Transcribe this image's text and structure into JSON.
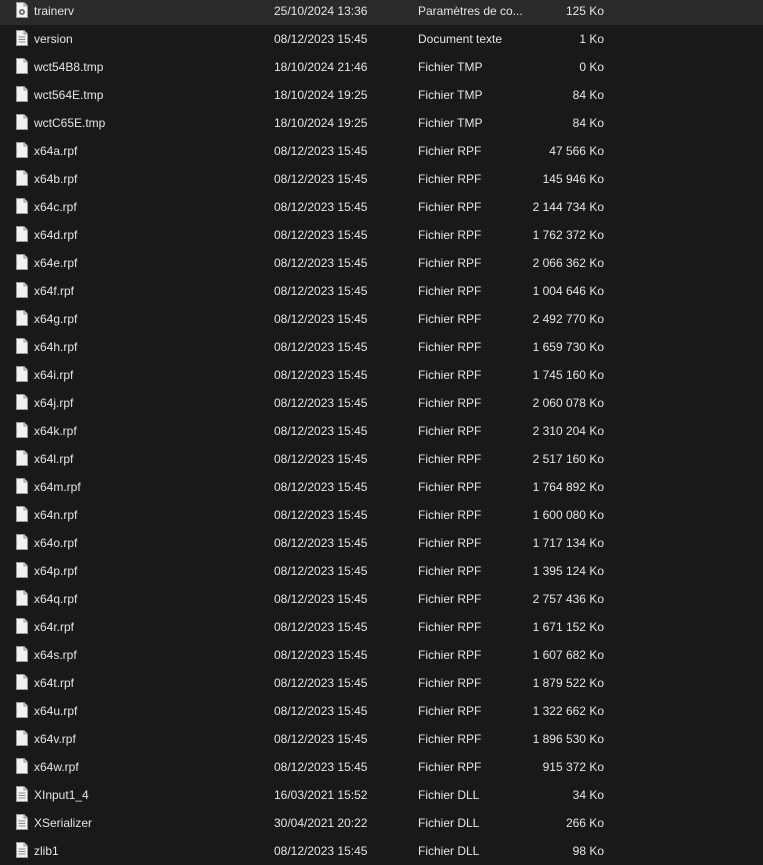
{
  "files": [
    {
      "name": "trainerv",
      "date": "25/10/2024 13:36",
      "type": "Paramètres de co...",
      "size": "125 Ko",
      "icon": "settings-file-icon"
    },
    {
      "name": "version",
      "date": "08/12/2023 15:45",
      "type": "Document texte",
      "size": "1 Ko",
      "icon": "text-document-icon"
    },
    {
      "name": "wct54B8.tmp",
      "date": "18/10/2024 21:46",
      "type": "Fichier TMP",
      "size": "0 Ko",
      "icon": "file-icon"
    },
    {
      "name": "wct564E.tmp",
      "date": "18/10/2024 19:25",
      "type": "Fichier TMP",
      "size": "84 Ko",
      "icon": "file-icon"
    },
    {
      "name": "wctC65E.tmp",
      "date": "18/10/2024 19:25",
      "type": "Fichier TMP",
      "size": "84 Ko",
      "icon": "file-icon"
    },
    {
      "name": "x64a.rpf",
      "date": "08/12/2023 15:45",
      "type": "Fichier RPF",
      "size": "47 566 Ko",
      "icon": "file-icon"
    },
    {
      "name": "x64b.rpf",
      "date": "08/12/2023 15:45",
      "type": "Fichier RPF",
      "size": "145 946 Ko",
      "icon": "file-icon"
    },
    {
      "name": "x64c.rpf",
      "date": "08/12/2023 15:45",
      "type": "Fichier RPF",
      "size": "2 144 734 Ko",
      "icon": "file-icon"
    },
    {
      "name": "x64d.rpf",
      "date": "08/12/2023 15:45",
      "type": "Fichier RPF",
      "size": "1 762 372 Ko",
      "icon": "file-icon"
    },
    {
      "name": "x64e.rpf",
      "date": "08/12/2023 15:45",
      "type": "Fichier RPF",
      "size": "2 066 362 Ko",
      "icon": "file-icon"
    },
    {
      "name": "x64f.rpf",
      "date": "08/12/2023 15:45",
      "type": "Fichier RPF",
      "size": "1 004 646 Ko",
      "icon": "file-icon"
    },
    {
      "name": "x64g.rpf",
      "date": "08/12/2023 15:45",
      "type": "Fichier RPF",
      "size": "2 492 770 Ko",
      "icon": "file-icon"
    },
    {
      "name": "x64h.rpf",
      "date": "08/12/2023 15:45",
      "type": "Fichier RPF",
      "size": "1 659 730 Ko",
      "icon": "file-icon"
    },
    {
      "name": "x64i.rpf",
      "date": "08/12/2023 15:45",
      "type": "Fichier RPF",
      "size": "1 745 160 Ko",
      "icon": "file-icon"
    },
    {
      "name": "x64j.rpf",
      "date": "08/12/2023 15:45",
      "type": "Fichier RPF",
      "size": "2 060 078 Ko",
      "icon": "file-icon"
    },
    {
      "name": "x64k.rpf",
      "date": "08/12/2023 15:45",
      "type": "Fichier RPF",
      "size": "2 310 204 Ko",
      "icon": "file-icon"
    },
    {
      "name": "x64l.rpf",
      "date": "08/12/2023 15:45",
      "type": "Fichier RPF",
      "size": "2 517 160 Ko",
      "icon": "file-icon"
    },
    {
      "name": "x64m.rpf",
      "date": "08/12/2023 15:45",
      "type": "Fichier RPF",
      "size": "1 764 892 Ko",
      "icon": "file-icon"
    },
    {
      "name": "x64n.rpf",
      "date": "08/12/2023 15:45",
      "type": "Fichier RPF",
      "size": "1 600 080 Ko",
      "icon": "file-icon"
    },
    {
      "name": "x64o.rpf",
      "date": "08/12/2023 15:45",
      "type": "Fichier RPF",
      "size": "1 717 134 Ko",
      "icon": "file-icon"
    },
    {
      "name": "x64p.rpf",
      "date": "08/12/2023 15:45",
      "type": "Fichier RPF",
      "size": "1 395 124 Ko",
      "icon": "file-icon"
    },
    {
      "name": "x64q.rpf",
      "date": "08/12/2023 15:45",
      "type": "Fichier RPF",
      "size": "2 757 436 Ko",
      "icon": "file-icon"
    },
    {
      "name": "x64r.rpf",
      "date": "08/12/2023 15:45",
      "type": "Fichier RPF",
      "size": "1 671 152 Ko",
      "icon": "file-icon"
    },
    {
      "name": "x64s.rpf",
      "date": "08/12/2023 15:45",
      "type": "Fichier RPF",
      "size": "1 607 682 Ko",
      "icon": "file-icon"
    },
    {
      "name": "x64t.rpf",
      "date": "08/12/2023 15:45",
      "type": "Fichier RPF",
      "size": "1 879 522 Ko",
      "icon": "file-icon"
    },
    {
      "name": "x64u.rpf",
      "date": "08/12/2023 15:45",
      "type": "Fichier RPF",
      "size": "1 322 662 Ko",
      "icon": "file-icon"
    },
    {
      "name": "x64v.rpf",
      "date": "08/12/2023 15:45",
      "type": "Fichier RPF",
      "size": "1 896 530 Ko",
      "icon": "file-icon"
    },
    {
      "name": "x64w.rpf",
      "date": "08/12/2023 15:45",
      "type": "Fichier RPF",
      "size": "915 372 Ko",
      "icon": "file-icon"
    },
    {
      "name": "XInput1_4",
      "date": "16/03/2021 15:52",
      "type": "Fichier DLL",
      "size": "34 Ko",
      "icon": "dll-file-icon"
    },
    {
      "name": "XSerializer",
      "date": "30/04/2021 20:22",
      "type": "Fichier DLL",
      "size": "266 Ko",
      "icon": "dll-file-icon"
    },
    {
      "name": "zlib1",
      "date": "08/12/2023 15:45",
      "type": "Fichier DLL",
      "size": "98 Ko",
      "icon": "dll-file-icon"
    }
  ],
  "colors": {
    "background": "#191919",
    "text": "#e6e6e6",
    "icon_fill": "#f2f2f2",
    "icon_stroke": "#9a9a9a",
    "column_divider": "#3a3a3a"
  }
}
